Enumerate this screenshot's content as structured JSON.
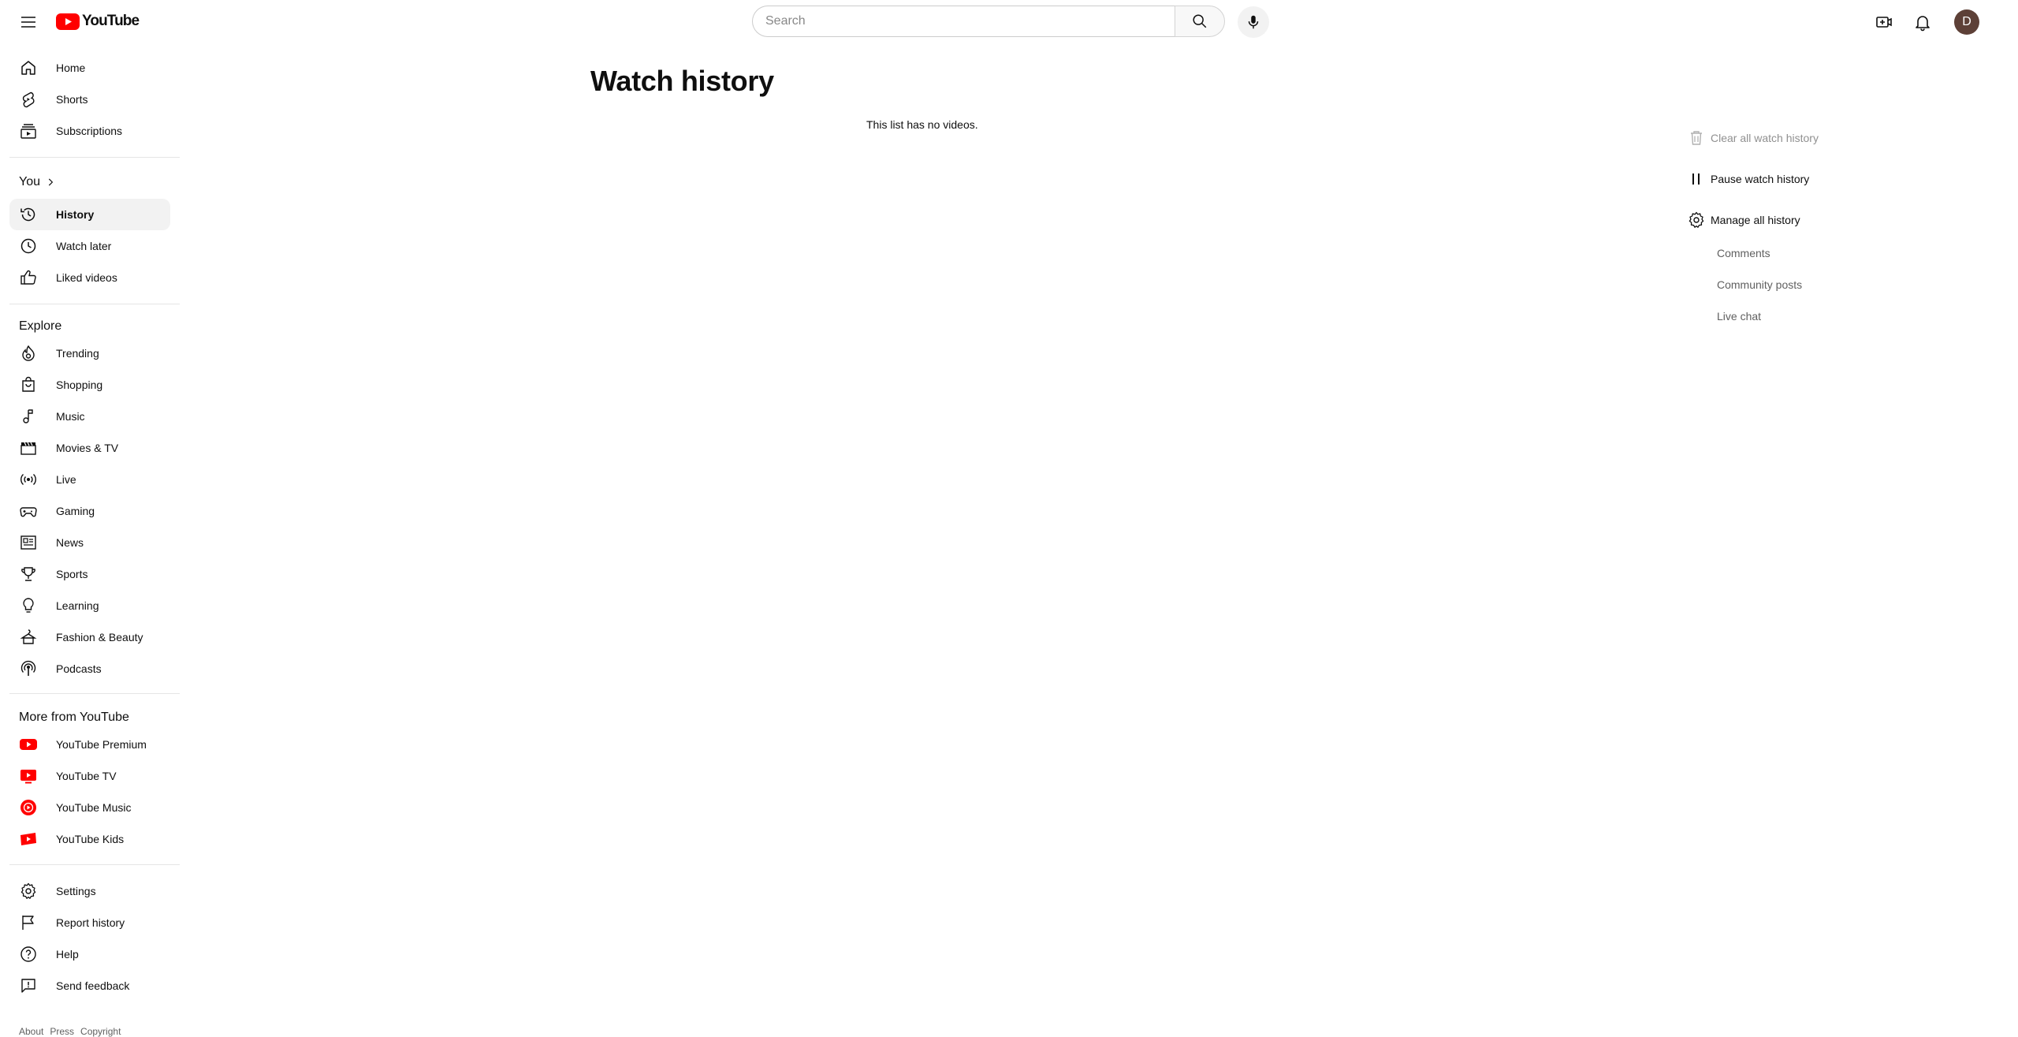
{
  "header": {
    "logo_text": "YouTube",
    "search_placeholder": "Search",
    "avatar_letter": "D",
    "brand_red": "#ff0000"
  },
  "sidebar": {
    "main": [
      {
        "label": "Home",
        "icon": "home-icon"
      },
      {
        "label": "Shorts",
        "icon": "shorts-icon"
      },
      {
        "label": "Subscriptions",
        "icon": "subscriptions-icon"
      }
    ],
    "you_title": "You",
    "you": [
      {
        "label": "History",
        "icon": "history-icon",
        "active": true
      },
      {
        "label": "Watch later",
        "icon": "clock-icon"
      },
      {
        "label": "Liked videos",
        "icon": "thumbs-up-icon"
      }
    ],
    "explore_title": "Explore",
    "explore": [
      {
        "label": "Trending",
        "icon": "flame-icon"
      },
      {
        "label": "Shopping",
        "icon": "shopping-bag-icon"
      },
      {
        "label": "Music",
        "icon": "music-note-icon"
      },
      {
        "label": "Movies & TV",
        "icon": "clapperboard-icon"
      },
      {
        "label": "Live",
        "icon": "live-broadcast-icon"
      },
      {
        "label": "Gaming",
        "icon": "gamepad-icon"
      },
      {
        "label": "News",
        "icon": "newspaper-icon"
      },
      {
        "label": "Sports",
        "icon": "trophy-icon"
      },
      {
        "label": "Learning",
        "icon": "lightbulb-icon"
      },
      {
        "label": "Fashion & Beauty",
        "icon": "hanger-icon"
      },
      {
        "label": "Podcasts",
        "icon": "podcast-icon"
      }
    ],
    "more_title": "More from YouTube",
    "more": [
      {
        "label": "YouTube Premium",
        "icon": "youtube-premium-icon"
      },
      {
        "label": "YouTube TV",
        "icon": "youtube-tv-icon"
      },
      {
        "label": "YouTube Music",
        "icon": "youtube-music-icon"
      },
      {
        "label": "YouTube Kids",
        "icon": "youtube-kids-icon"
      }
    ],
    "bottom": [
      {
        "label": "Settings",
        "icon": "gear-icon"
      },
      {
        "label": "Report history",
        "icon": "flag-icon"
      },
      {
        "label": "Help",
        "icon": "help-icon"
      },
      {
        "label": "Send feedback",
        "icon": "feedback-icon"
      }
    ],
    "footer": [
      "About",
      "Press",
      "Copyright"
    ]
  },
  "main": {
    "title": "Watch history",
    "empty_message": "This list has no videos."
  },
  "right_panel": {
    "clear_label": "Clear all watch history",
    "pause_label": "Pause watch history",
    "manage_label": "Manage all history",
    "sub_links": [
      "Comments",
      "Community posts",
      "Live chat"
    ]
  }
}
